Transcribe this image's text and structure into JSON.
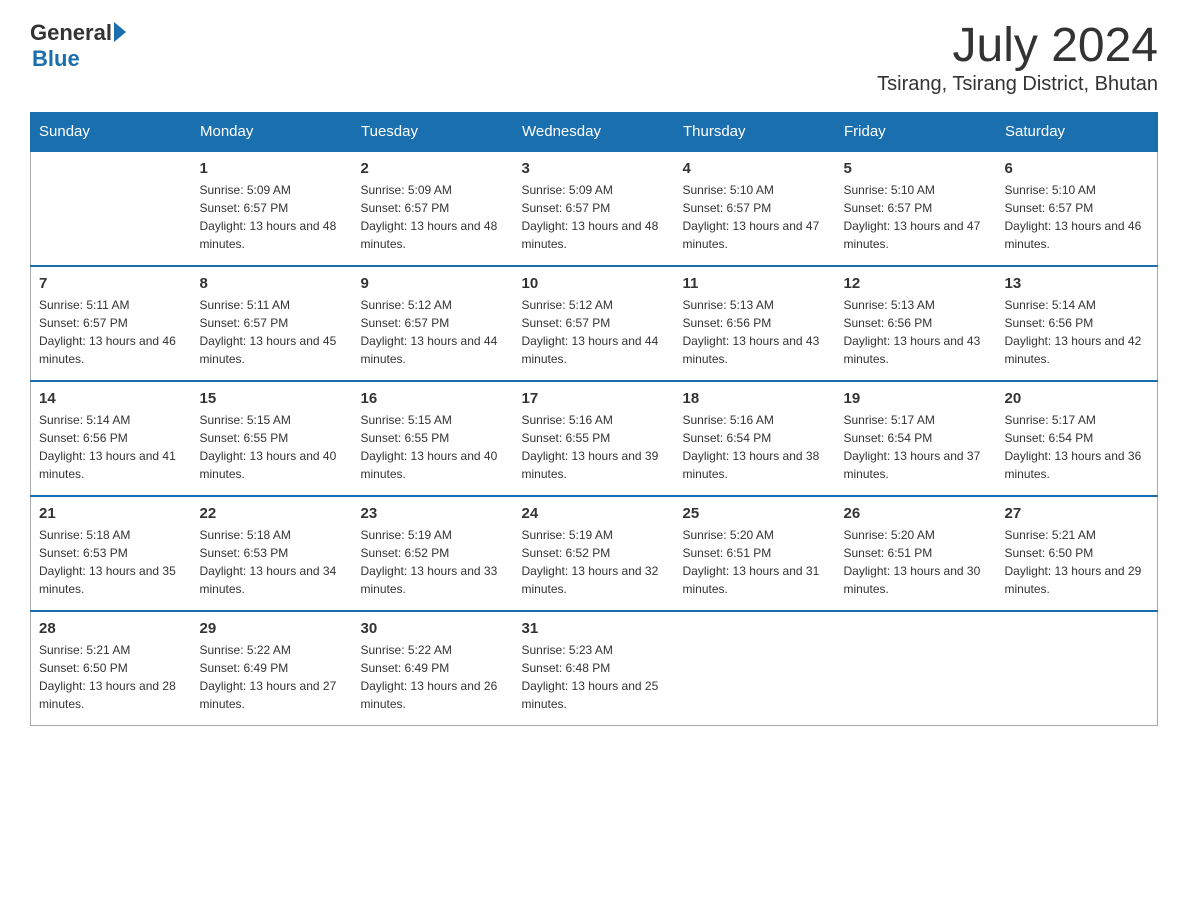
{
  "logo": {
    "general": "General",
    "arrow": "▶",
    "blue": "Blue"
  },
  "title": {
    "month_year": "July 2024",
    "location": "Tsirang, Tsirang District, Bhutan"
  },
  "weekdays": [
    "Sunday",
    "Monday",
    "Tuesday",
    "Wednesday",
    "Thursday",
    "Friday",
    "Saturday"
  ],
  "weeks": [
    [
      {
        "day": "",
        "sunrise": "",
        "sunset": "",
        "daylight": ""
      },
      {
        "day": "1",
        "sunrise": "Sunrise: 5:09 AM",
        "sunset": "Sunset: 6:57 PM",
        "daylight": "Daylight: 13 hours and 48 minutes."
      },
      {
        "day": "2",
        "sunrise": "Sunrise: 5:09 AM",
        "sunset": "Sunset: 6:57 PM",
        "daylight": "Daylight: 13 hours and 48 minutes."
      },
      {
        "day": "3",
        "sunrise": "Sunrise: 5:09 AM",
        "sunset": "Sunset: 6:57 PM",
        "daylight": "Daylight: 13 hours and 48 minutes."
      },
      {
        "day": "4",
        "sunrise": "Sunrise: 5:10 AM",
        "sunset": "Sunset: 6:57 PM",
        "daylight": "Daylight: 13 hours and 47 minutes."
      },
      {
        "day": "5",
        "sunrise": "Sunrise: 5:10 AM",
        "sunset": "Sunset: 6:57 PM",
        "daylight": "Daylight: 13 hours and 47 minutes."
      },
      {
        "day": "6",
        "sunrise": "Sunrise: 5:10 AM",
        "sunset": "Sunset: 6:57 PM",
        "daylight": "Daylight: 13 hours and 46 minutes."
      }
    ],
    [
      {
        "day": "7",
        "sunrise": "Sunrise: 5:11 AM",
        "sunset": "Sunset: 6:57 PM",
        "daylight": "Daylight: 13 hours and 46 minutes."
      },
      {
        "day": "8",
        "sunrise": "Sunrise: 5:11 AM",
        "sunset": "Sunset: 6:57 PM",
        "daylight": "Daylight: 13 hours and 45 minutes."
      },
      {
        "day": "9",
        "sunrise": "Sunrise: 5:12 AM",
        "sunset": "Sunset: 6:57 PM",
        "daylight": "Daylight: 13 hours and 44 minutes."
      },
      {
        "day": "10",
        "sunrise": "Sunrise: 5:12 AM",
        "sunset": "Sunset: 6:57 PM",
        "daylight": "Daylight: 13 hours and 44 minutes."
      },
      {
        "day": "11",
        "sunrise": "Sunrise: 5:13 AM",
        "sunset": "Sunset: 6:56 PM",
        "daylight": "Daylight: 13 hours and 43 minutes."
      },
      {
        "day": "12",
        "sunrise": "Sunrise: 5:13 AM",
        "sunset": "Sunset: 6:56 PM",
        "daylight": "Daylight: 13 hours and 43 minutes."
      },
      {
        "day": "13",
        "sunrise": "Sunrise: 5:14 AM",
        "sunset": "Sunset: 6:56 PM",
        "daylight": "Daylight: 13 hours and 42 minutes."
      }
    ],
    [
      {
        "day": "14",
        "sunrise": "Sunrise: 5:14 AM",
        "sunset": "Sunset: 6:56 PM",
        "daylight": "Daylight: 13 hours and 41 minutes."
      },
      {
        "day": "15",
        "sunrise": "Sunrise: 5:15 AM",
        "sunset": "Sunset: 6:55 PM",
        "daylight": "Daylight: 13 hours and 40 minutes."
      },
      {
        "day": "16",
        "sunrise": "Sunrise: 5:15 AM",
        "sunset": "Sunset: 6:55 PM",
        "daylight": "Daylight: 13 hours and 40 minutes."
      },
      {
        "day": "17",
        "sunrise": "Sunrise: 5:16 AM",
        "sunset": "Sunset: 6:55 PM",
        "daylight": "Daylight: 13 hours and 39 minutes."
      },
      {
        "day": "18",
        "sunrise": "Sunrise: 5:16 AM",
        "sunset": "Sunset: 6:54 PM",
        "daylight": "Daylight: 13 hours and 38 minutes."
      },
      {
        "day": "19",
        "sunrise": "Sunrise: 5:17 AM",
        "sunset": "Sunset: 6:54 PM",
        "daylight": "Daylight: 13 hours and 37 minutes."
      },
      {
        "day": "20",
        "sunrise": "Sunrise: 5:17 AM",
        "sunset": "Sunset: 6:54 PM",
        "daylight": "Daylight: 13 hours and 36 minutes."
      }
    ],
    [
      {
        "day": "21",
        "sunrise": "Sunrise: 5:18 AM",
        "sunset": "Sunset: 6:53 PM",
        "daylight": "Daylight: 13 hours and 35 minutes."
      },
      {
        "day": "22",
        "sunrise": "Sunrise: 5:18 AM",
        "sunset": "Sunset: 6:53 PM",
        "daylight": "Daylight: 13 hours and 34 minutes."
      },
      {
        "day": "23",
        "sunrise": "Sunrise: 5:19 AM",
        "sunset": "Sunset: 6:52 PM",
        "daylight": "Daylight: 13 hours and 33 minutes."
      },
      {
        "day": "24",
        "sunrise": "Sunrise: 5:19 AM",
        "sunset": "Sunset: 6:52 PM",
        "daylight": "Daylight: 13 hours and 32 minutes."
      },
      {
        "day": "25",
        "sunrise": "Sunrise: 5:20 AM",
        "sunset": "Sunset: 6:51 PM",
        "daylight": "Daylight: 13 hours and 31 minutes."
      },
      {
        "day": "26",
        "sunrise": "Sunrise: 5:20 AM",
        "sunset": "Sunset: 6:51 PM",
        "daylight": "Daylight: 13 hours and 30 minutes."
      },
      {
        "day": "27",
        "sunrise": "Sunrise: 5:21 AM",
        "sunset": "Sunset: 6:50 PM",
        "daylight": "Daylight: 13 hours and 29 minutes."
      }
    ],
    [
      {
        "day": "28",
        "sunrise": "Sunrise: 5:21 AM",
        "sunset": "Sunset: 6:50 PM",
        "daylight": "Daylight: 13 hours and 28 minutes."
      },
      {
        "day": "29",
        "sunrise": "Sunrise: 5:22 AM",
        "sunset": "Sunset: 6:49 PM",
        "daylight": "Daylight: 13 hours and 27 minutes."
      },
      {
        "day": "30",
        "sunrise": "Sunrise: 5:22 AM",
        "sunset": "Sunset: 6:49 PM",
        "daylight": "Daylight: 13 hours and 26 minutes."
      },
      {
        "day": "31",
        "sunrise": "Sunrise: 5:23 AM",
        "sunset": "Sunset: 6:48 PM",
        "daylight": "Daylight: 13 hours and 25 minutes."
      },
      {
        "day": "",
        "sunrise": "",
        "sunset": "",
        "daylight": ""
      },
      {
        "day": "",
        "sunrise": "",
        "sunset": "",
        "daylight": ""
      },
      {
        "day": "",
        "sunrise": "",
        "sunset": "",
        "daylight": ""
      }
    ]
  ]
}
